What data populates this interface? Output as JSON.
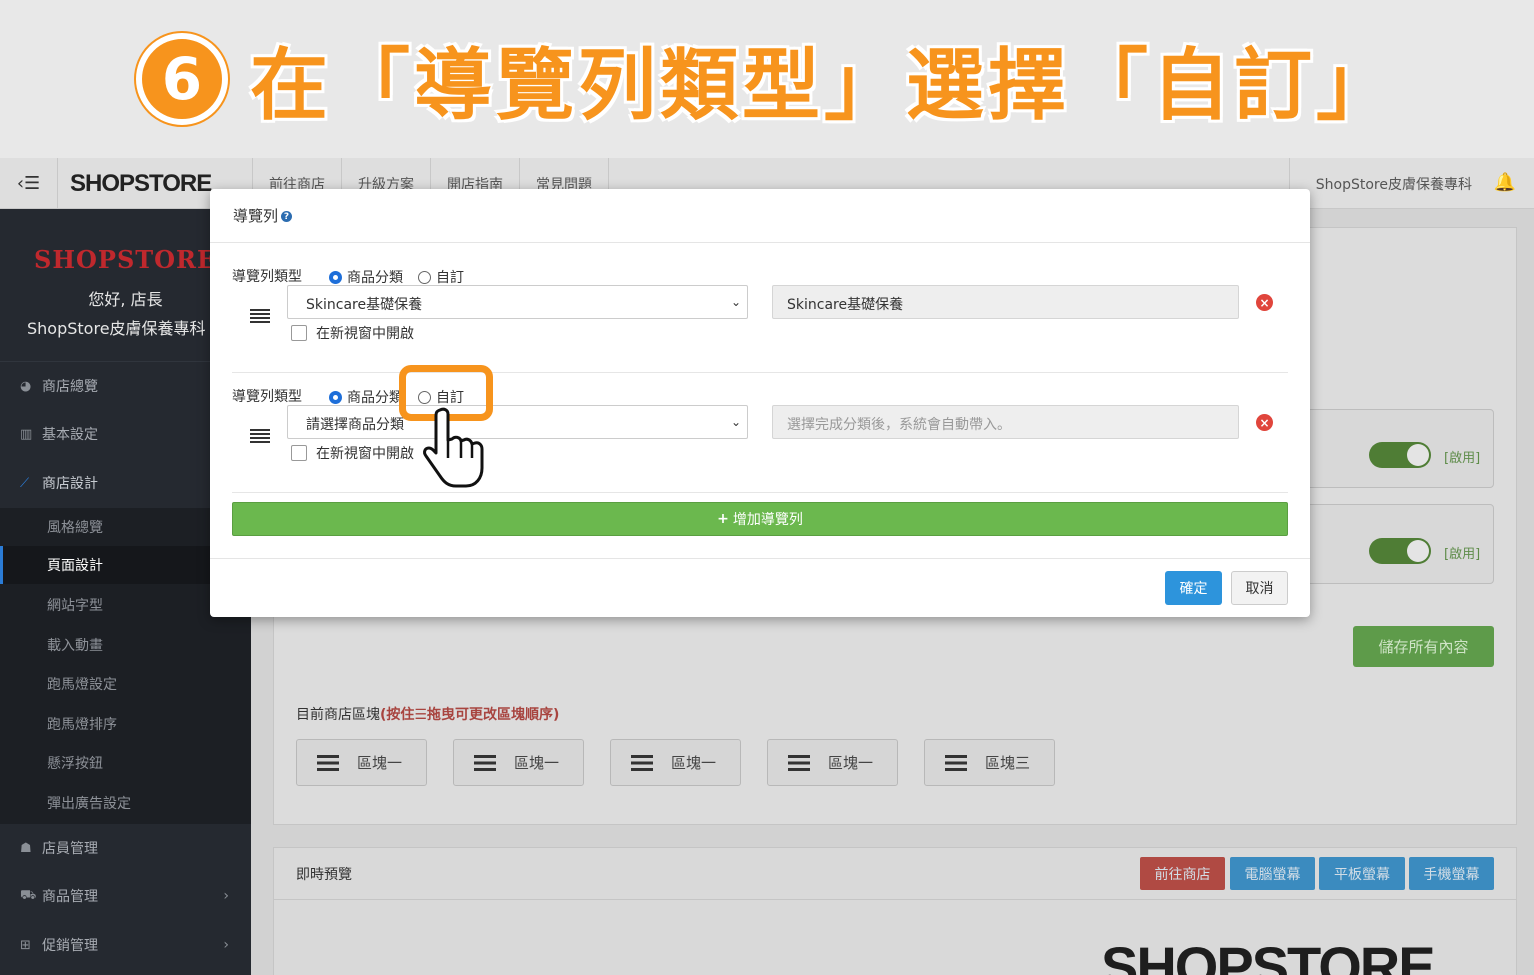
{
  "banner": {
    "step": "6",
    "title": "在「導覽列類型」選擇「自訂」"
  },
  "topbar": {
    "brand": "SHOPSTORE",
    "nav": [
      "前往商店",
      "升級方案",
      "開店指南",
      "常見問題"
    ],
    "shop_name": "ShopStore皮膚保養專科"
  },
  "sidebar": {
    "logo": "SHOPSTORE",
    "greeting": "您好, 店長",
    "shop": "ShopStore皮膚保養專科",
    "menu_top": [
      "商店總覽",
      "基本設定",
      "商店設計"
    ],
    "submenu": [
      "風格總覽",
      "頁面設計",
      "網站字型",
      "載入動畫",
      "跑馬燈設定",
      "跑馬燈排序",
      "懸浮按鈕",
      "彈出廣告設定"
    ],
    "menu_bottom": [
      "店員管理",
      "商品管理",
      "促銷管理"
    ]
  },
  "main": {
    "enabled_label": "[啟用]",
    "save_all": "儲存所有內容",
    "blocks_label": "目前商店區塊",
    "blocks_hint": "(按住☰拖曳可更改區塊順序)",
    "blocks": [
      "區塊一",
      "區塊一",
      "區塊一",
      "區塊一",
      "區塊三"
    ],
    "preview_label": "即時預覽",
    "preview_buttons": [
      "前往商店",
      "電腦螢幕",
      "平板螢幕",
      "手機螢幕"
    ],
    "preview_logo": "SHOPSTORE"
  },
  "modal": {
    "title": "導覽列",
    "rows": [
      {
        "type_label": "導覽列類型",
        "option_category": "商品分類",
        "option_custom": "自訂",
        "select_value": "Skincare基礎保養",
        "field_value": "Skincare基礎保養",
        "field_placeholder": "",
        "checkbox_label": "在新視窗中開啟"
      },
      {
        "type_label": "導覽列類型",
        "option_category": "商品分類",
        "option_custom": "自訂",
        "select_value": "請選擇商品分類",
        "field_value": "",
        "field_placeholder": "選擇完成分類後，系統會自動帶入。",
        "checkbox_label": "在新視窗中開啟"
      }
    ],
    "add_button": "增加導覽列",
    "confirm": "確定",
    "cancel": "取消"
  },
  "colors": {
    "accent": "#f7941d",
    "primary": "#2d94dc",
    "success": "#6bb84e",
    "danger": "#e0453c"
  }
}
